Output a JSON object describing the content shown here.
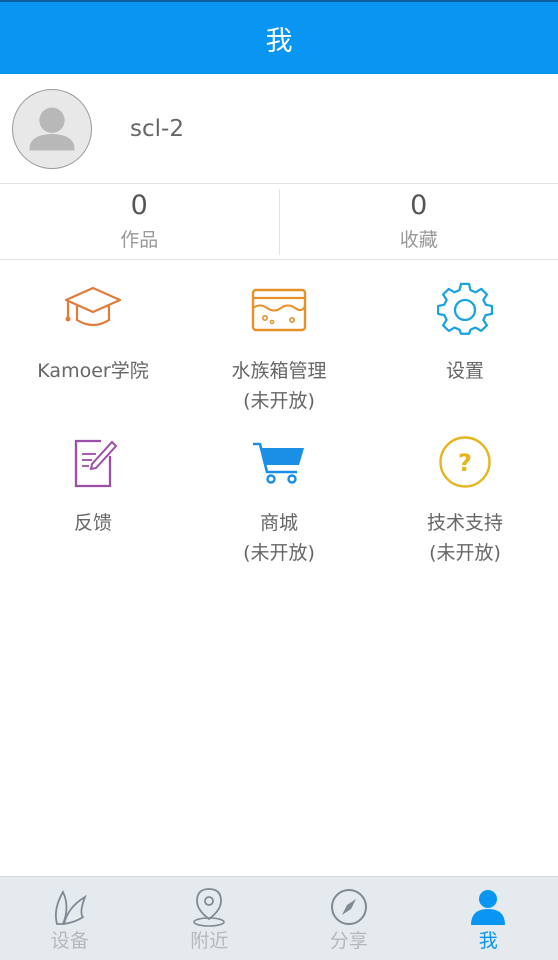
{
  "header": {
    "title": "我"
  },
  "profile": {
    "avatar_icon": "person-silhouette-icon",
    "username": "scl-2"
  },
  "stats": [
    {
      "value": "0",
      "label": "作品"
    },
    {
      "value": "0",
      "label": "收藏"
    }
  ],
  "menu": [
    {
      "icon": "graduation-cap-icon",
      "line1": "Kamoer学院",
      "line2": "",
      "color": "#e07b39"
    },
    {
      "icon": "aquarium-tank-icon",
      "line1": "水族箱管理",
      "line2": "(未开放)",
      "color": "#e8902a"
    },
    {
      "icon": "gear-icon",
      "line1": "设置",
      "line2": "",
      "color": "#1aa3e0"
    },
    {
      "icon": "edit-note-icon",
      "line1": "反馈",
      "line2": "",
      "color": "#9b4fa8"
    },
    {
      "icon": "shopping-cart-icon",
      "line1": "商城",
      "line2": "(未开放)",
      "color": "#1b8fe6"
    },
    {
      "icon": "question-circle-icon",
      "line1": "技术支持",
      "line2": "(未开放)",
      "color": "#e6b41c"
    }
  ],
  "tabs": [
    {
      "icon": "leaf-icon",
      "label": "设备",
      "active": false
    },
    {
      "icon": "location-pin-icon",
      "label": "附近",
      "active": false
    },
    {
      "icon": "compass-icon",
      "label": "分享",
      "active": false
    },
    {
      "icon": "person-icon",
      "label": "我",
      "active": true
    }
  ],
  "colors": {
    "primary": "#0996f2",
    "tab_inactive": "#b5b9bc",
    "tabbar_bg": "#e5eaee"
  }
}
